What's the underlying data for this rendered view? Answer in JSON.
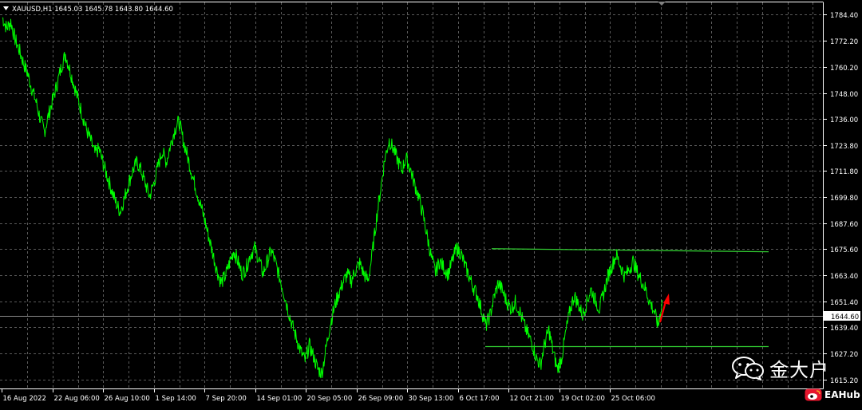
{
  "symbol_header": {
    "text": "XAUUSD,H1  1645.03 1645.78 1643.80 1644.60"
  },
  "chart_data": {
    "type": "line",
    "title": "XAUUSD,H1",
    "ohlc_readout": {
      "open": 1645.03,
      "high": 1645.78,
      "low": 1643.8,
      "close": 1644.6
    },
    "current_price": 1644.6,
    "current_price_label": "1644.60",
    "ylim": [
      1611.0,
      1790.0
    ],
    "y_ticks": [
      "1784.40",
      "1772.20",
      "1760.20",
      "1748.00",
      "1736.00",
      "1723.80",
      "1711.80",
      "1699.80",
      "1687.60",
      "1675.60",
      "1663.40",
      "1651.40",
      "1639.40",
      "1627.20",
      "1615.20"
    ],
    "x_ticks": [
      "16 Aug 2022",
      "22 Aug 06:00",
      "26 Aug 10:00",
      "1 Sep 14:00",
      "7 Sep 20:00",
      "14 Sep 01:00",
      "20 Sep 05:00",
      "26 Sep 09:00",
      "30 Sep 13:00",
      "6 Oct 17:00",
      "12 Oct 21:00",
      "19 Oct 02:00",
      "25 Oct 06:00"
    ],
    "grid": true,
    "colors": {
      "background": "#000000",
      "price": "#00ff00",
      "grid": "#5a5a5a",
      "axis_text": "#ffffff",
      "arrow": "#ff0000",
      "level_lines": "#32cd32"
    },
    "series": [
      {
        "values": [
          1783,
          1778,
          1781,
          1773,
          1768,
          1762,
          1757,
          1750,
          1744,
          1736,
          1730,
          1738,
          1745,
          1752,
          1760,
          1766,
          1759,
          1752,
          1745,
          1738,
          1731,
          1726,
          1720,
          1722,
          1715,
          1709,
          1703,
          1697,
          1693,
          1699,
          1706,
          1712,
          1716,
          1712,
          1706,
          1700,
          1706,
          1714,
          1721,
          1716,
          1724,
          1731,
          1735,
          1726,
          1719,
          1711,
          1704,
          1697,
          1690,
          1682,
          1674,
          1666,
          1660,
          1663,
          1669,
          1675,
          1670,
          1664,
          1667,
          1673,
          1676,
          1671,
          1664,
          1670,
          1675,
          1669,
          1662,
          1655,
          1647,
          1640,
          1634,
          1628,
          1624,
          1631,
          1626,
          1620,
          1618,
          1630,
          1641,
          1649,
          1655,
          1660,
          1664,
          1661,
          1666,
          1669,
          1664,
          1661,
          1674,
          1690,
          1704,
          1718,
          1726,
          1722,
          1717,
          1712,
          1718,
          1713,
          1706,
          1700,
          1692,
          1682,
          1672,
          1665,
          1670,
          1667,
          1664,
          1670,
          1676,
          1674,
          1668,
          1663,
          1658,
          1654,
          1647,
          1640,
          1645,
          1654,
          1660,
          1656,
          1651,
          1648,
          1651,
          1647,
          1641,
          1636,
          1632,
          1625,
          1622,
          1632,
          1638,
          1628,
          1620,
          1625,
          1637,
          1647,
          1654,
          1650,
          1645,
          1651,
          1657,
          1652,
          1648,
          1655,
          1663,
          1668,
          1673,
          1668,
          1663,
          1666,
          1670,
          1665,
          1661,
          1657,
          1651,
          1647,
          1640,
          1652
        ]
      }
    ],
    "levels": [
      {
        "role": "resistance",
        "start": 1675.8,
        "end": 1674.4
      },
      {
        "role": "support",
        "start": 1630.4,
        "end": 1630.4
      }
    ]
  },
  "watermarks": {
    "wechat_name": "金大户",
    "eahub": "EAHub",
    "wechat_icon": "wechat-logo",
    "eahub_icon": "eahub-logo"
  }
}
